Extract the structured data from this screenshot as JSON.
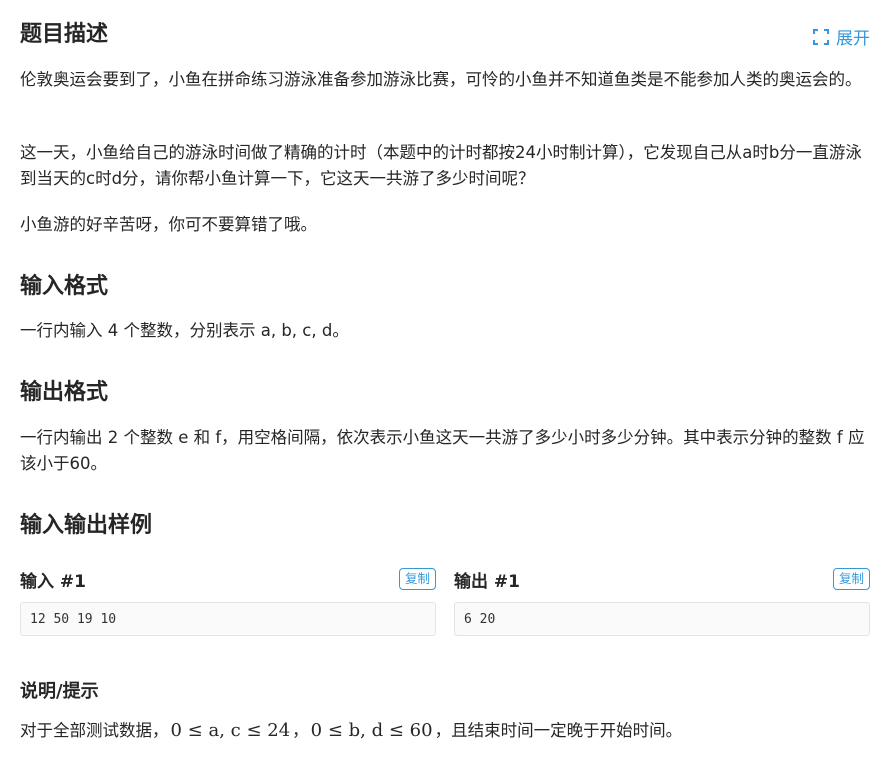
{
  "expand": {
    "label": "展开",
    "icon": "expand-icon"
  },
  "description": {
    "title": "题目描述",
    "paragraphs": [
      "伦敦奥运会要到了，小鱼在拼命练习游泳准备参加游泳比赛，可怜的小鱼并不知道鱼类是不能参加人类的奥运会的。",
      "这一天，小鱼给自己的游泳时间做了精确的计时（本题中的计时都按24小时制计算），它发现自己从a时b分一直游泳到当天的c时d分，请你帮小鱼计算一下，它这天一共游了多少时间呢？",
      "小鱼游的好辛苦呀，你可不要算错了哦。"
    ]
  },
  "input_format": {
    "title": "输入格式",
    "text": "一行内输入 4 个整数，分别表示 a, b, c, d。"
  },
  "output_format": {
    "title": "输出格式",
    "text": "一行内输出 2 个整数 e 和 f，用空格间隔，依次表示小鱼这天一共游了多少小时多少分钟。其中表示分钟的整数 f 应该小于60。"
  },
  "samples": {
    "title": "输入输出样例",
    "input": {
      "title": "输入 #1",
      "copy_label": "复制",
      "content": "12 50 19 10"
    },
    "output": {
      "title": "输出 #1",
      "copy_label": "复制",
      "content": "6 20"
    }
  },
  "note": {
    "title": "说明/提示",
    "prefix": "对于全部测试数据，",
    "math1": "0 ≤ a, c ≤ 24",
    "sep": "，",
    "math2": "0 ≤ b, d ≤ 60",
    "suffix": "，且结束时间一定晚于开始时间。"
  }
}
